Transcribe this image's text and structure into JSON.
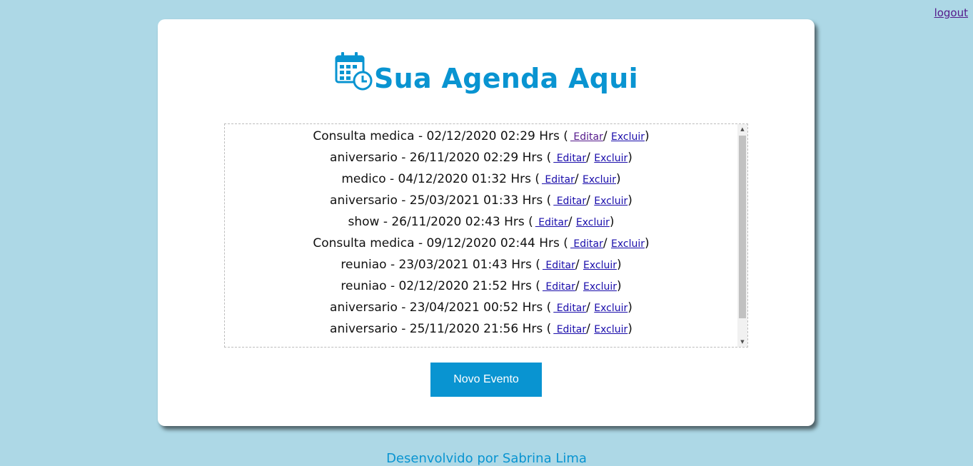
{
  "header": {
    "logout_label": "logout"
  },
  "card": {
    "title": "Sua Agenda Aqui",
    "icon": "calendar-clock-icon",
    "events": [
      {
        "text": "Consulta medica - 02/12/2020 02:29 Hrs (",
        "edit": " Editar",
        "sep": "/ ",
        "delete": "Excluir",
        "close": ")"
      },
      {
        "text": "aniversario - 26/11/2020 02:29 Hrs (",
        "edit": " Editar",
        "sep": "/ ",
        "delete": "Excluir",
        "close": ")"
      },
      {
        "text": "medico - 04/12/2020 01:32 Hrs (",
        "edit": " Editar",
        "sep": "/ ",
        "delete": "Excluir",
        "close": ")"
      },
      {
        "text": "aniversario - 25/03/2021 01:33 Hrs (",
        "edit": " Editar",
        "sep": "/ ",
        "delete": "Excluir",
        "close": ")"
      },
      {
        "text": "show - 26/11/2020 02:43 Hrs (",
        "edit": " Editar",
        "sep": "/ ",
        "delete": "Excluir",
        "close": ")"
      },
      {
        "text": "Consulta medica - 09/12/2020 02:44 Hrs (",
        "edit": " Editar",
        "sep": "/ ",
        "delete": "Excluir",
        "close": ")"
      },
      {
        "text": "reuniao - 23/03/2021 01:43 Hrs (",
        "edit": " Editar",
        "sep": "/ ",
        "delete": "Excluir",
        "close": ")"
      },
      {
        "text": "reuniao - 02/12/2020 21:52 Hrs (",
        "edit": " Editar",
        "sep": "/ ",
        "delete": "Excluir",
        "close": ")"
      },
      {
        "text": "aniversario - 23/04/2021 00:52 Hrs (",
        "edit": " Editar",
        "sep": "/ ",
        "delete": "Excluir",
        "close": ")"
      },
      {
        "text": "aniversario - 25/11/2020 21:56 Hrs (",
        "edit": " Editar",
        "sep": "/ ",
        "delete": "Excluir",
        "close": ")"
      }
    ],
    "new_event_label": "Novo Evento"
  },
  "footer": {
    "credit": "Desenvolvido por Sabrina Lima"
  },
  "colors": {
    "background": "#add8e6",
    "accent": "#0994d1",
    "link": "#1a0dab",
    "visited_link": "#551a8b"
  }
}
